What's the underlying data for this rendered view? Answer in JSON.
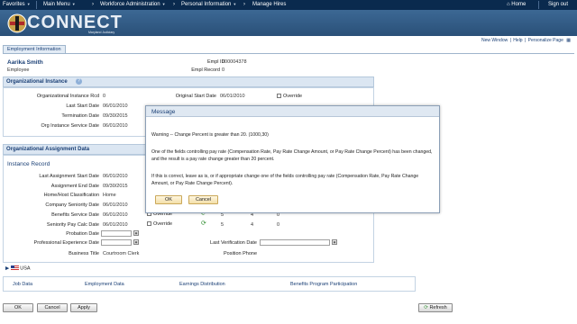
{
  "nav": {
    "favorites": "Favorites",
    "main_menu": "Main Menu",
    "crumb1": "Workforce Administration",
    "crumb2": "Personal Information",
    "crumb3": "Manage Hires",
    "home": "Home",
    "sign_out": "Sign out"
  },
  "brand": {
    "name": "CONNECT",
    "sub": "Maryland Judiciary"
  },
  "toplinks": {
    "new_window": "New Window",
    "help": "Help",
    "personalize": "Personalize Page"
  },
  "tab": {
    "label": "Employment Information"
  },
  "employee": {
    "name": "Aarika Smith",
    "role": "Employee",
    "empl_id_label": "Empl ID",
    "empl_id": "000004378",
    "empl_record_label": "Empl Record",
    "empl_record": "0"
  },
  "org_instance": {
    "title": "Organizational Instance",
    "rcd_label": "Organizational Instance Rcd",
    "rcd": "0",
    "orig_start_label": "Original Start Date",
    "orig_start": "06/01/2010",
    "override": "Override",
    "last_start_label": "Last Start Date",
    "last_start": "06/01/2010",
    "term_label": "Termination Date",
    "term": "09/30/2015",
    "org_service_label": "Org Instance Service Date",
    "org_service": "06/01/2010"
  },
  "org_assignment": {
    "title": "Organizational Assignment Data",
    "instance_record": "Instance Record",
    "last_assign_label": "Last Assignment Start Date",
    "last_assign": "06/01/2010",
    "assign_end_label": "Assignment End Date",
    "assign_end": "09/30/2015",
    "home_host_label": "Home/Host Classification",
    "home_host": "Home",
    "company_seniority_label": "Company Seniority Date",
    "company_seniority": "06/01/2010",
    "benefits_service_label": "Benefits Service Date",
    "benefits_service": "06/01/2010",
    "seniority_pay_label": "Seniority Pay Calc Date",
    "seniority_pay": "06/01/2010",
    "override": "Override",
    "row1": [
      "5",
      "4",
      "0"
    ],
    "row2": [
      "5",
      "4",
      "0"
    ],
    "probation_label": "Probation Date",
    "prof_exp_label": "Professional Experience Date",
    "last_verif_label": "Last Verification Date",
    "business_title_label": "Business Title",
    "business_title": "Courtroom Clerk",
    "position_phone_label": "Position Phone"
  },
  "country": {
    "label": "USA"
  },
  "bottom_links": [
    "Job Data",
    "Employment Data",
    "Earnings Distribution",
    "Benefits Program Participation"
  ],
  "buttons": {
    "ok": "OK",
    "cancel": "Cancel",
    "apply": "Apply",
    "refresh": "Refresh"
  },
  "modal": {
    "title": "Message",
    "line1": "Warning -- Change Percent is greater than 20. (1000,30)",
    "para2": "One of the fields controlling pay rate (Compensation Rate, Pay Rate Change Amount, or Pay Rate Change Percent) has been changed, and the result is a pay rate change greater than 20 percent.",
    "para3": "If this is correct, leave as is, or if appropriate change one of the fields controlling pay rate (Compensation Rate, Pay Rate Change Amount, or Pay Rate Change Percent).",
    "ok": "OK",
    "cancel": "Cancel"
  }
}
